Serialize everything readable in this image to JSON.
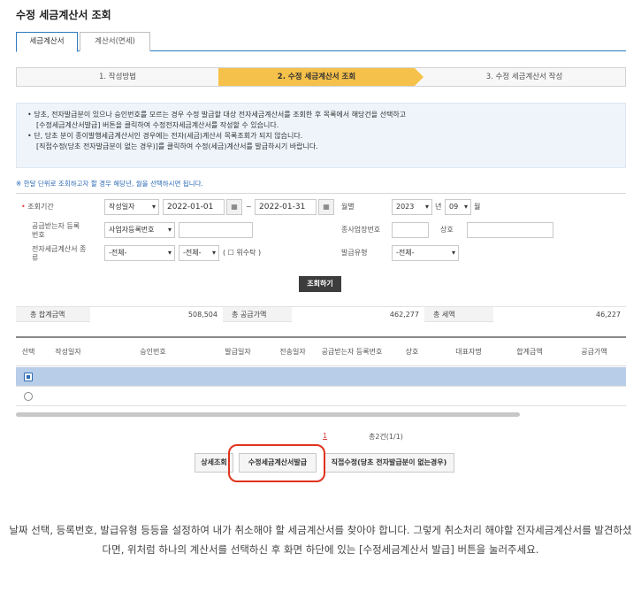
{
  "page_title": "수정 세금계산서 조회",
  "tabs": [
    {
      "label": "세금계산서"
    },
    {
      "label": "계산서(면세)"
    }
  ],
  "steps": [
    {
      "label": "1. 작성방법"
    },
    {
      "label": "2. 수정 세금계산서 조회"
    },
    {
      "label": "3. 수정 세금계산서 작성"
    }
  ],
  "info": {
    "line1": "• 당초, 전자발급분이 있으나 승인번호를 모르는 경우 수정 발급할 대상 전자세금계산서를 조회한 후 목록에서 해당건을 선택하고",
    "line2": "[수정세금계산서발급] 버튼을 클릭하여 수정전자세금계산서를 작성할 수 있습니다.",
    "line3": "• 단, 당초 분이 종이발행세금계산서인 경우에는 전자(세금)계산서 목록조회가 되지 않습니다.",
    "line4": "[직접수정(당초 전자발급분이 없는 경우)]를 클릭하여 수정(세금)계산서를 발급하시기 바랍니다."
  },
  "note": "※ 한달 단위로 조회하고자 할 경우 해당년, 월을 선택하시면 됩니다.",
  "form": {
    "period_label": "조회기간",
    "date_type": "작성일자",
    "date_from": "2022-01-01",
    "date_sep": "~",
    "date_to": "2022-01-31",
    "monthly_label": "월별",
    "year": "2023",
    "year_unit": "년",
    "month": "09",
    "month_unit": "월",
    "receiver_label": "공급받는자 등록번호",
    "reg_type": "사업자등록번호",
    "branch_label": "종사업장번호",
    "name_label": "상호",
    "kind_label": "전자세금계산서 종류",
    "kind1": "-전체-",
    "kind2": "-전체-",
    "consign_label": "( ☐ 위수탁 )",
    "issue_type_label": "발급유형",
    "issue_type": "-전체-"
  },
  "search_button": "조회하기",
  "totals": {
    "total_label": "총 합계금액",
    "total_value": "508,504",
    "supply_label": "총 공급가액",
    "supply_value": "462,277",
    "tax_label": "총 세액",
    "tax_value": "46,227"
  },
  "grid": {
    "headers": [
      "선택",
      "작성일자",
      "승인번호",
      "발급일자",
      "전송일자",
      "공급받는자 등록번호",
      "상호",
      "대표자명",
      "합계금액",
      "공급가액"
    ]
  },
  "pager": {
    "current": "1",
    "summary": "총2건(1/1)"
  },
  "buttons": {
    "detail": "상세조회",
    "issue": "수정세금계산서발급",
    "direct": "직접수정(당초 전자발급분이 없는경우)"
  },
  "caption": "날짜 선택, 등록번호, 발급유형 등등을 설정하여 내가 취소해야 할 세금계산서를 찾아야 합니다. 그렇게 취소처리 해야할 전자세금계산서를 발견하셨다면, 위처럼 하나의 계산서를 선택하신 후 화면 하단에 있는 [수정세금계산서 발급] 버튼을 눌러주세요.",
  "colors": {
    "accent": "#f6c14a",
    "link": "#2e6bb4",
    "highlight": "#e0331d"
  }
}
